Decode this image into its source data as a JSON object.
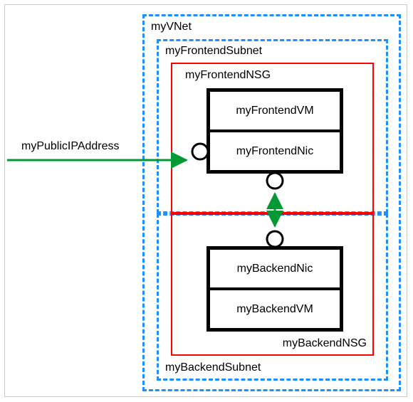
{
  "diagram": {
    "publicIpLabel": "myPublicIPAddress",
    "vnet": {
      "label": "myVNet",
      "frontendSubnet": {
        "label": "myFrontendSubnet",
        "nsg": {
          "label": "myFrontendNSG",
          "vm": {
            "label": "myFrontendVM"
          },
          "nic": {
            "label": "myFrontendNic"
          }
        }
      },
      "backendSubnet": {
        "label": "myBackendSubnet",
        "nsg": {
          "label": "myBackendNSG",
          "nic": {
            "label": "myBackendNic"
          },
          "vm": {
            "label": "myBackendVM"
          }
        }
      }
    }
  },
  "colors": {
    "dashed": "#1e90ff",
    "nsg": "#ff0000",
    "arrow": "#009933",
    "box": "#000000"
  }
}
